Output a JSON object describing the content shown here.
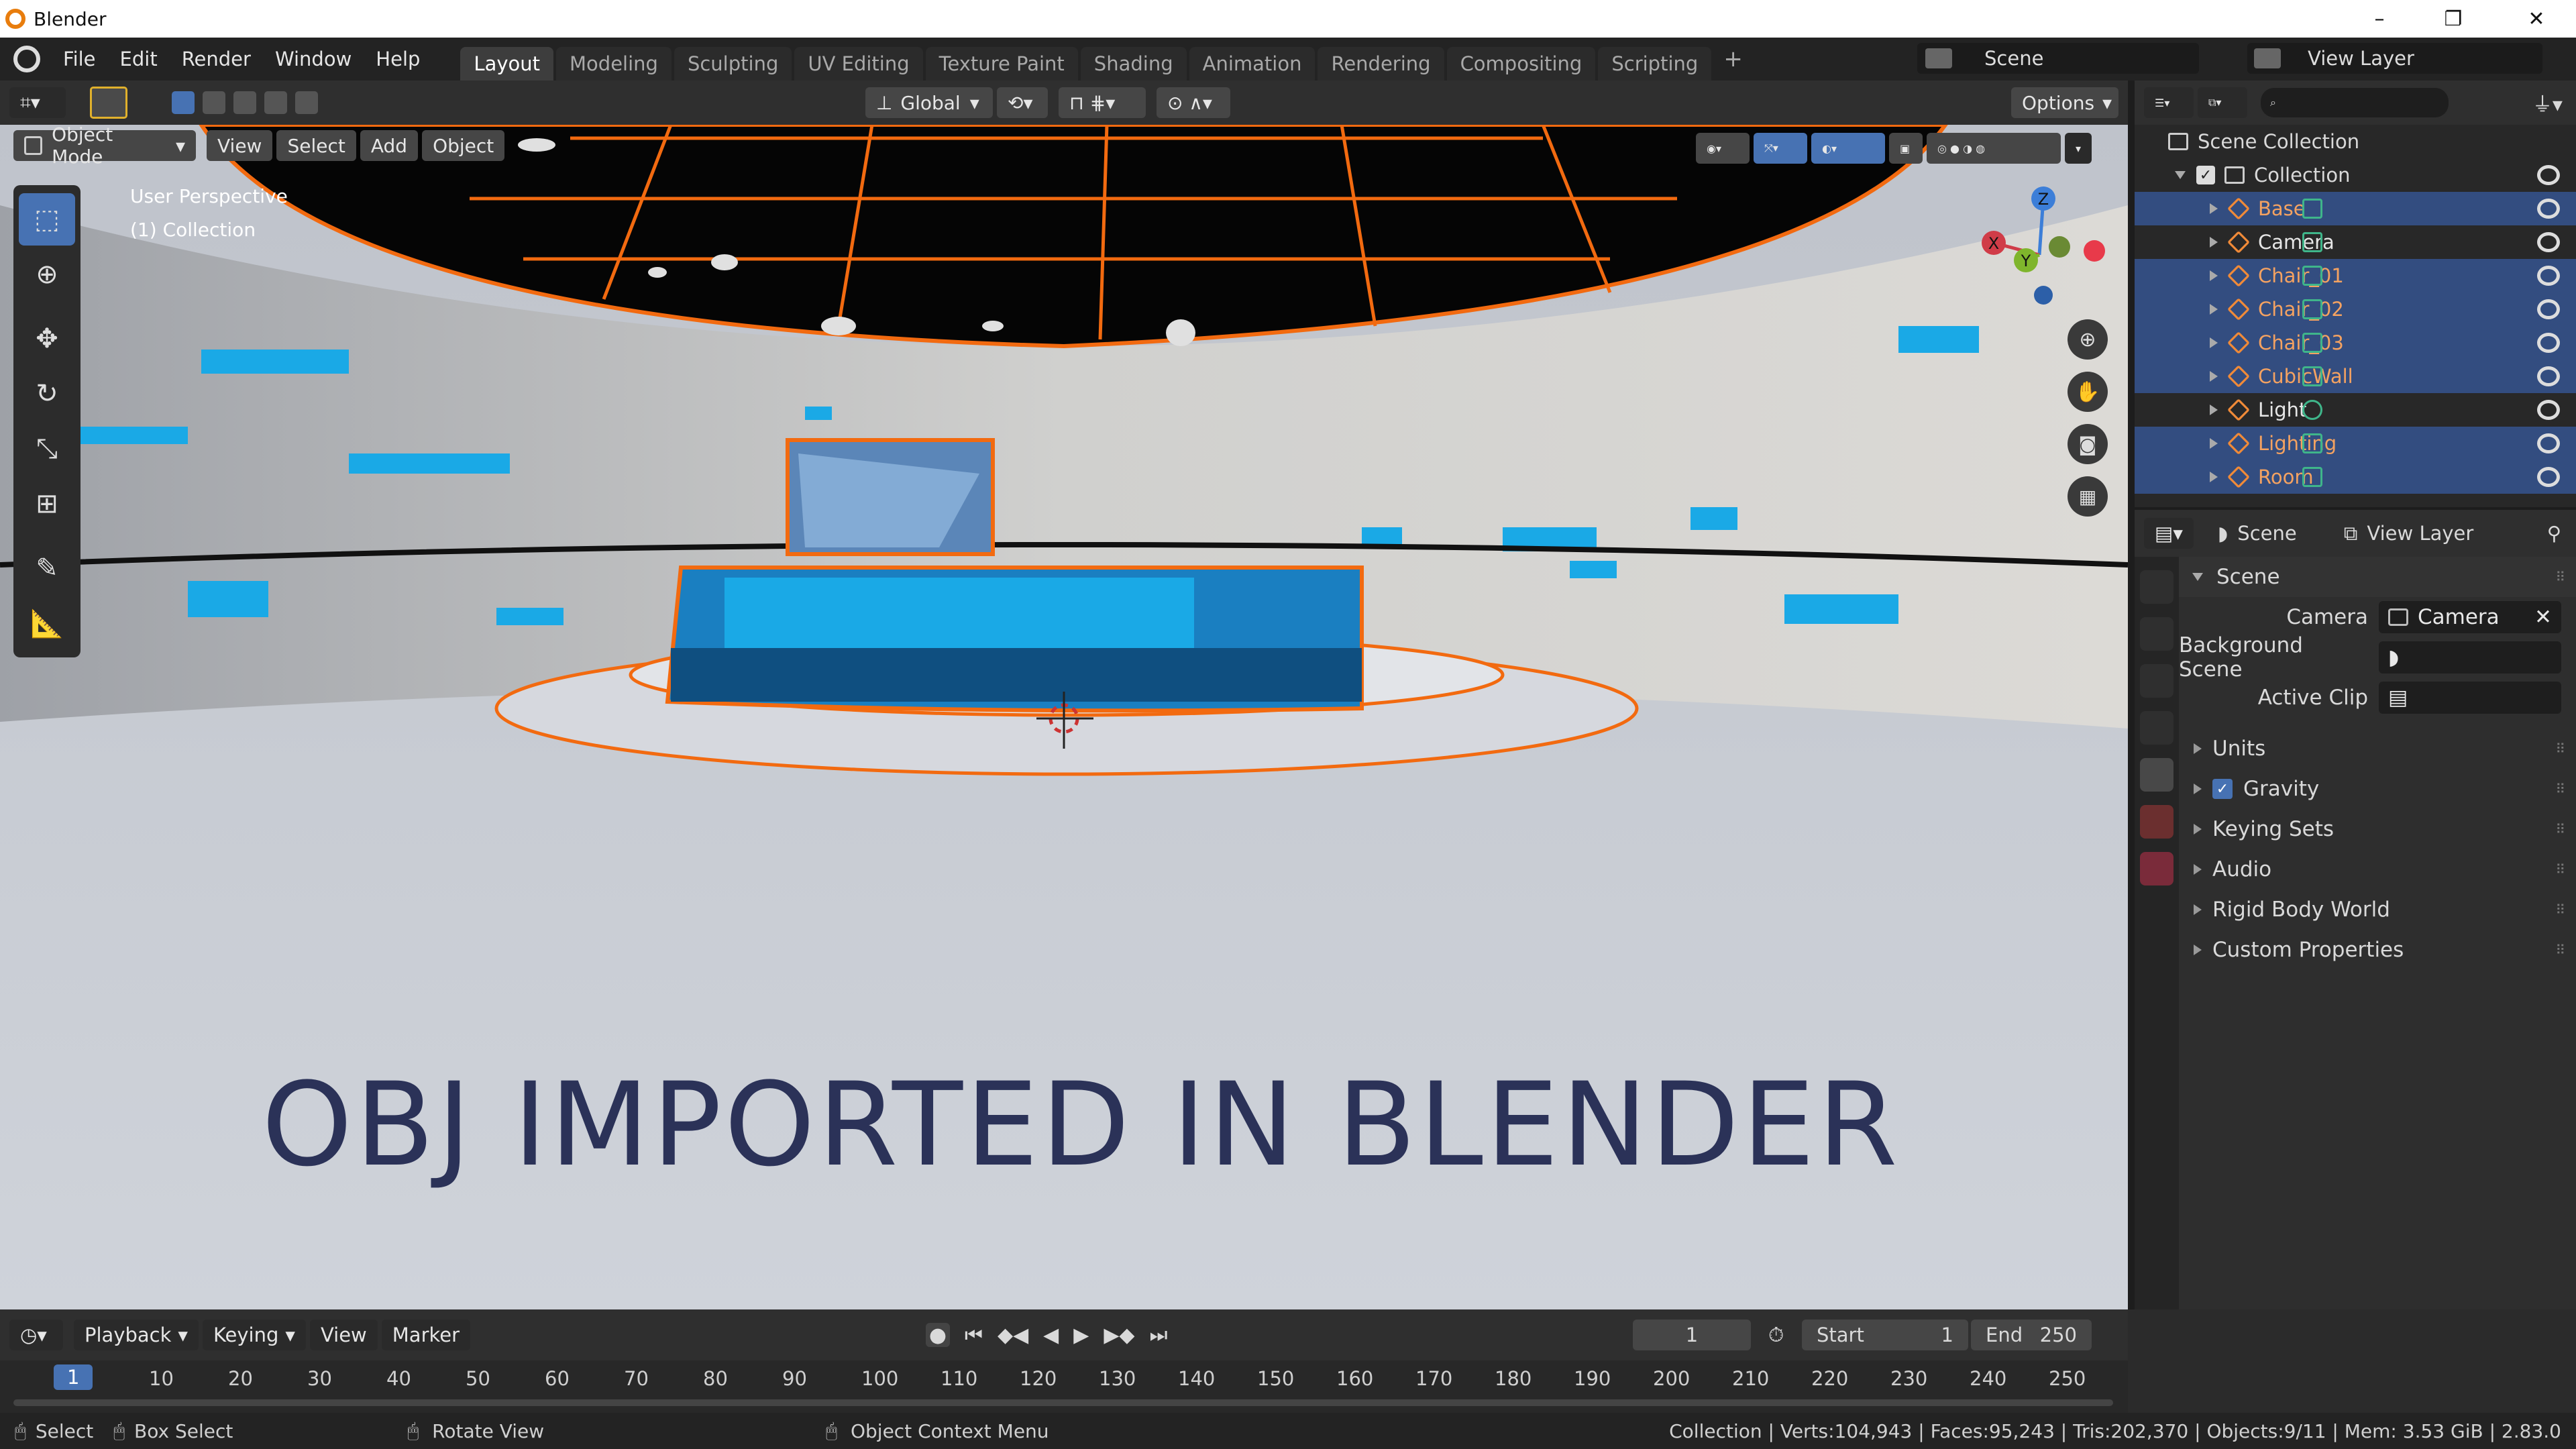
{
  "window": {
    "title": "Blender",
    "minimize": "–",
    "maximize": "❐",
    "close": "✕"
  },
  "menu": [
    "File",
    "Edit",
    "Render",
    "Window",
    "Help"
  ],
  "workspaces": [
    "Layout",
    "Modeling",
    "Sculpting",
    "UV Editing",
    "Texture Paint",
    "Shading",
    "Animation",
    "Rendering",
    "Compositing",
    "Scripting"
  ],
  "active_workspace": "Layout",
  "scene_selector": "Scene",
  "view_layer_selector": "View Layer",
  "viewport_header": {
    "mode": "Object Mode",
    "menus": [
      "View",
      "Select",
      "Add",
      "Object"
    ],
    "transform_orientation": "Global",
    "options": "Options"
  },
  "viewport_overlay": {
    "perspective": "User Perspective",
    "collection": "(1) Collection",
    "caption": "OBJ IMPORTED IN BLENDER",
    "gizmo": {
      "x": "X",
      "y": "Y",
      "z": "Z"
    }
  },
  "outliner": {
    "root": "Scene Collection",
    "collection": "Collection",
    "items": [
      {
        "name": "Base",
        "selected": true,
        "kind": "mesh"
      },
      {
        "name": "Camera",
        "selected": false,
        "kind": "camera"
      },
      {
        "name": "Chair_01",
        "selected": true,
        "kind": "mesh"
      },
      {
        "name": "Chair_02",
        "selected": true,
        "kind": "mesh"
      },
      {
        "name": "Chair_03",
        "selected": true,
        "kind": "mesh"
      },
      {
        "name": "CubicWall",
        "selected": true,
        "kind": "mesh"
      },
      {
        "name": "Light",
        "selected": false,
        "kind": "light"
      },
      {
        "name": "Lighting",
        "selected": true,
        "kind": "mesh"
      },
      {
        "name": "Room",
        "selected": true,
        "kind": "mesh"
      }
    ]
  },
  "properties": {
    "breadcrumb_scene": "Scene",
    "breadcrumb_view_layer": "View Layer",
    "panel_title": "Scene",
    "camera_label": "Camera",
    "camera_value": "Camera",
    "background_scene_label": "Background Scene",
    "active_clip_label": "Active Clip",
    "sections": [
      "Units",
      "Gravity",
      "Keying Sets",
      "Audio",
      "Rigid Body World",
      "Custom Properties"
    ],
    "gravity_checked": true
  },
  "timeline": {
    "menus": [
      "Playback",
      "Keying",
      "View",
      "Marker"
    ],
    "current_frame": "1",
    "start_label": "Start",
    "start": "1",
    "end_label": "End",
    "end": "250",
    "ruler": [
      "1",
      "10",
      "20",
      "30",
      "40",
      "50",
      "60",
      "70",
      "80",
      "90",
      "100",
      "110",
      "120",
      "130",
      "140",
      "150",
      "160",
      "170",
      "180",
      "190",
      "200",
      "210",
      "220",
      "230",
      "240",
      "250"
    ]
  },
  "statusbar": {
    "select": "Select",
    "box_select": "Box Select",
    "rotate_view": "Rotate View",
    "context_menu": "Object Context Menu",
    "stats": "Collection | Verts:104,943 | Faces:95,243 | Tris:202,370 | Objects:9/11 | Mem: 3.53 GiB | 2.83.0"
  },
  "colors": {
    "selection_blue": "#334d80",
    "selected_name": "#f4a261",
    "active_tool": "#4772b3",
    "outline_orange": "#f26a10",
    "screen_blue": "#1aa9e6",
    "caption": "#2b3258"
  }
}
